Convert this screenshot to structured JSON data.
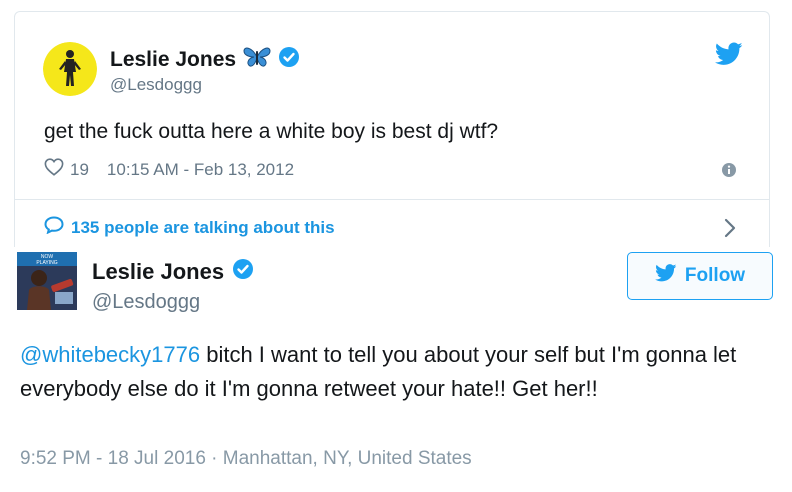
{
  "tweet1": {
    "display_name": "Leslie Jones",
    "handle": "@Lesdoggg",
    "text": "get the fuck outta here a white boy is best dj wtf?",
    "likes": "19",
    "timestamp": "10:15 AM - Feb 13, 2012",
    "talking": "135 people are talking about this",
    "icons": [
      "butterfly-emoji",
      "verified-badge",
      "twitter-bird",
      "heart",
      "info",
      "speech-bubble",
      "chevron-right"
    ]
  },
  "tweet2": {
    "display_name": "Leslie Jones",
    "handle": "@Lesdoggg",
    "follow_label": "Follow",
    "mention": "@whitebecky1776",
    "text_body": " bitch I want to tell you about your self but I'm gonna let everybody else do it I'm gonna retweet your hate!! Get her!!",
    "meta": "9:52 PM - 18 Jul 2016 · Manhattan, NY, United States"
  },
  "colors": {
    "accent": "#1da1f2",
    "link": "#1b95e0",
    "muted": "#657786",
    "text": "#14171a",
    "verified": "#1da1f2"
  }
}
